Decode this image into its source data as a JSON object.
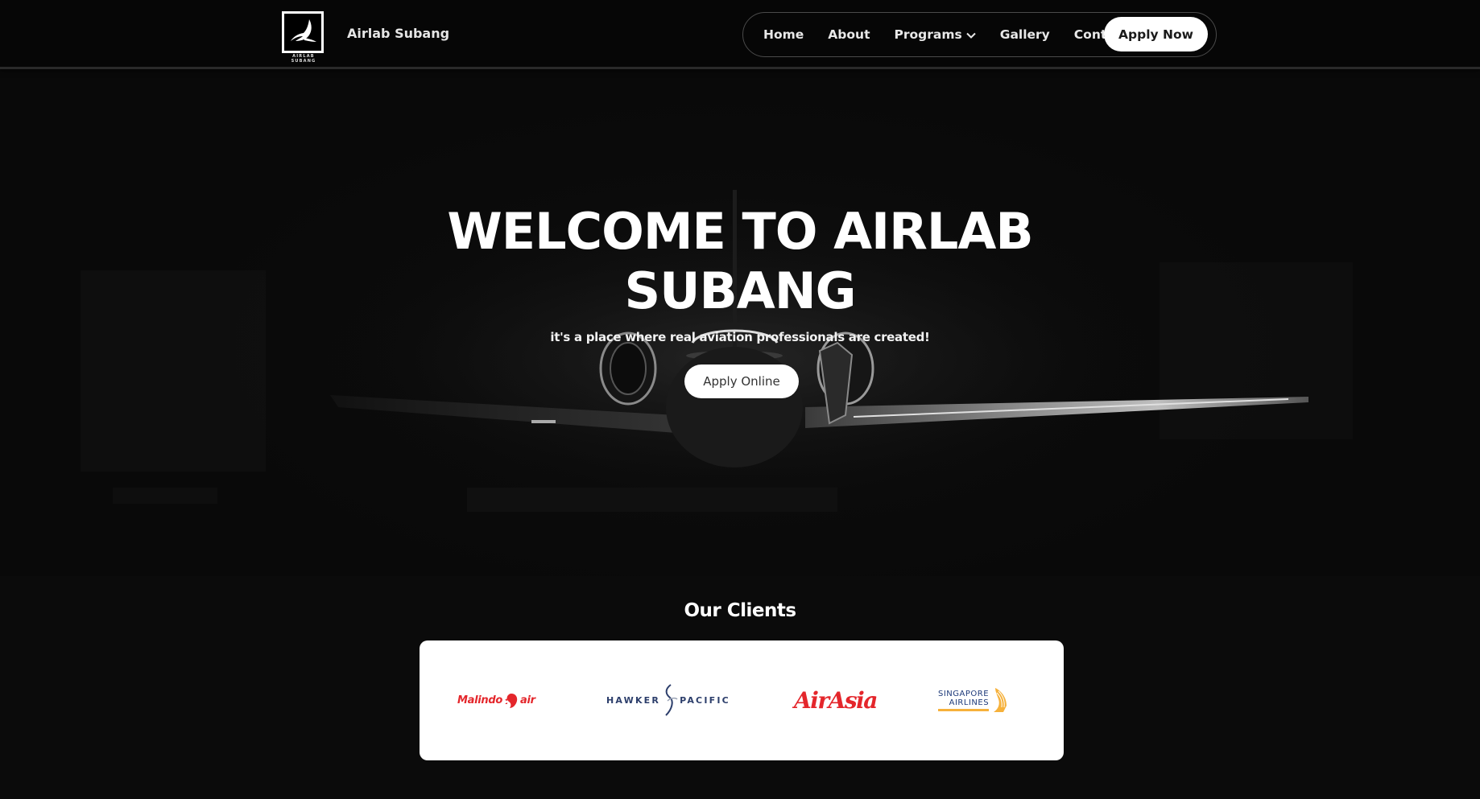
{
  "header": {
    "logo_caption": "AIRLAB SUBANG",
    "brand_name": "Airlab Subang",
    "nav": [
      {
        "label": "Home"
      },
      {
        "label": "About"
      },
      {
        "label": "Programs",
        "has_dropdown": true
      },
      {
        "label": "Gallery"
      },
      {
        "label": "Contact"
      }
    ],
    "cta_label": "Apply Now"
  },
  "hero": {
    "title_line1": "WELCOME TO AIRLAB",
    "title_line2": "SUBANG",
    "subtitle": "it's a place where real aviation professionals are created!",
    "cta_label": "Apply Online"
  },
  "clients": {
    "title": "Our Clients",
    "logos": [
      {
        "name": "Malindo Air",
        "text_left": "Malindo",
        "text_right": "air",
        "color": "#e4262b"
      },
      {
        "name": "Hawker Pacific",
        "text_left": "HAWKER",
        "text_right": "PACIFIC",
        "color": "#2c3e6b"
      },
      {
        "name": "AirAsia",
        "text": "AirAsia",
        "color": "#e4262b"
      },
      {
        "name": "Singapore Airlines",
        "line1": "SINGAPORE",
        "line2": "AIRLINES",
        "color": "#1e3a7a",
        "accent": "#f6b13b"
      }
    ]
  },
  "colors": {
    "background": "#0b0b0b",
    "header_bg": "#060606",
    "button_bg": "#ffffff",
    "text": "#ffffff"
  }
}
